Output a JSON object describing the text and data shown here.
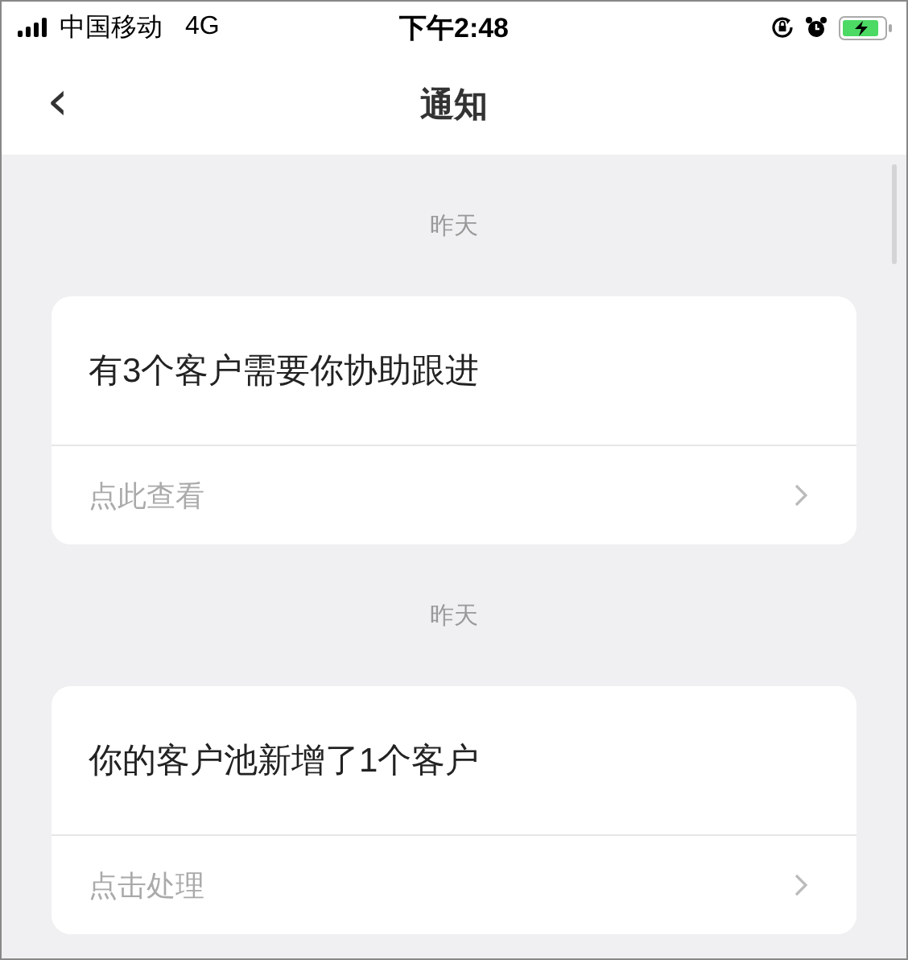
{
  "status_bar": {
    "carrier": "中国移动",
    "network": "4G",
    "time": "下午2:48"
  },
  "nav": {
    "back": "‹",
    "title": "通知"
  },
  "notifications": [
    {
      "date": "昨天",
      "message": "有3个客户需要你协助跟进",
      "action": "点此查看"
    },
    {
      "date": "昨天",
      "message": "你的客户池新增了1个客户",
      "action": "点击处理"
    }
  ]
}
